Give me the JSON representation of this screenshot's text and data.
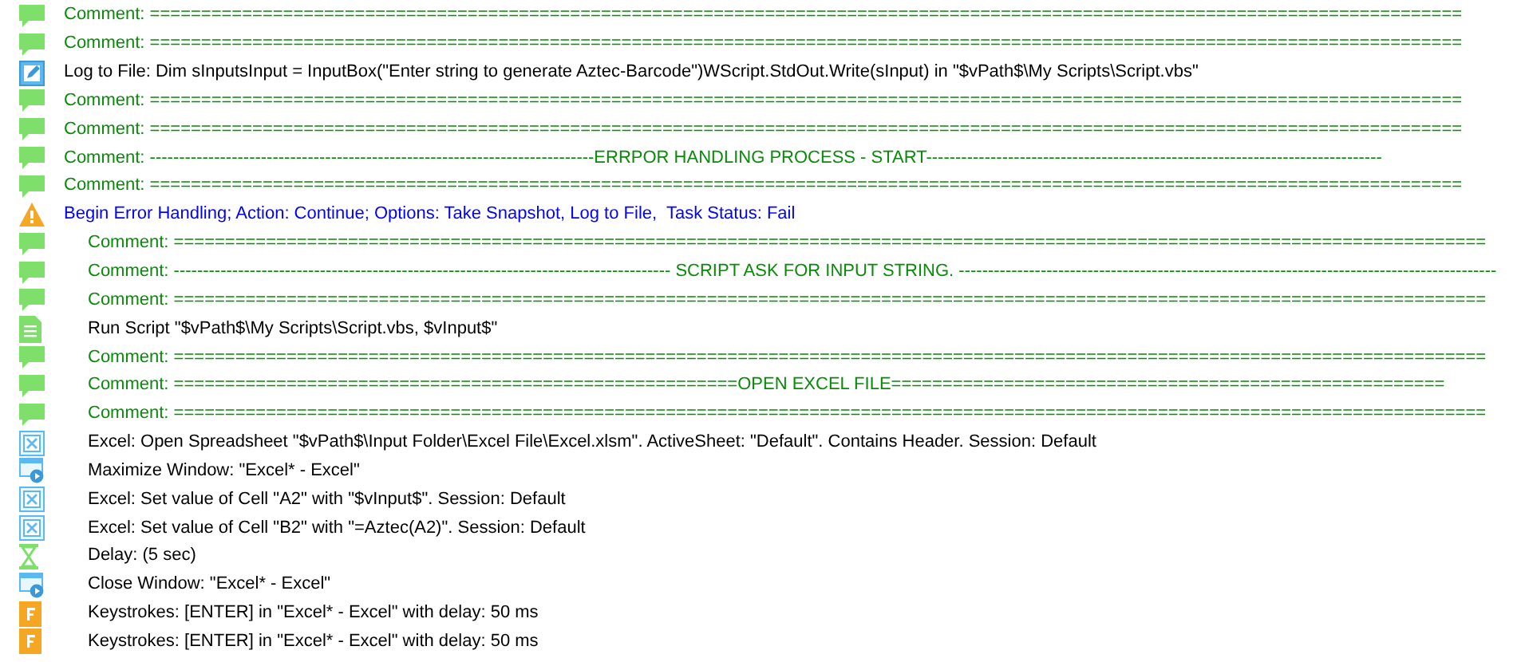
{
  "steps": [
    {
      "kind": "comment",
      "text": "Comment: ================================================================================================================================"
    },
    {
      "kind": "comment",
      "text": "Comment: ================================================================================================================================"
    },
    {
      "kind": "log",
      "text": "Log to File: Dim sInputsInput = InputBox(\"Enter string to generate Aztec-Barcode\")WScript.StdOut.Write(sInput) in \"$vPath$\\My Scripts\\Script.vbs\""
    },
    {
      "kind": "comment",
      "text": "Comment: ================================================================================================================================"
    },
    {
      "kind": "comment",
      "text": "Comment: ================================================================================================================================"
    },
    {
      "kind": "comment",
      "text": "Comment: ----------------------------------------------------------------------------ERRPOR HANDLING PROCESS - START------------------------------------------------------------------------------"
    },
    {
      "kind": "comment",
      "text": "Comment: ================================================================================================================================"
    },
    {
      "kind": "error",
      "text": "Begin Error Handling; Action: Continue; Options: Take Snapshot, Log to File,  Task Status: Fail",
      "children": [
        {
          "kind": "comment",
          "text": "Comment: ================================================================================================================================"
        },
        {
          "kind": "comment",
          "text": "Comment: ------------------------------------------------------------------------------------- SCRIPT ASK FOR INPUT STRING. --------------------------------------------------------------------------------------------"
        },
        {
          "kind": "comment",
          "text": "Comment: ================================================================================================================================"
        },
        {
          "kind": "script",
          "text": "Run Script \"$vPath$\\My Scripts\\Script.vbs, $vInput$\""
        },
        {
          "kind": "comment",
          "text": "Comment: ================================================================================================================================"
        },
        {
          "kind": "comment",
          "text": "Comment: =======================================================OPEN EXCEL FILE======================================================"
        },
        {
          "kind": "comment",
          "text": "Comment: ================================================================================================================================"
        },
        {
          "kind": "excel",
          "text": "Excel: Open Spreadsheet \"$vPath$\\Input Folder\\Excel File\\Excel.xlsm\". ActiveSheet: \"Default\". Contains Header. Session: Default"
        },
        {
          "kind": "window",
          "text": "Maximize Window: \"Excel* - Excel\""
        },
        {
          "kind": "excel",
          "text": "Excel: Set value of Cell \"A2\" with \"$vInput$\". Session: Default"
        },
        {
          "kind": "excel",
          "text": "Excel: Set value of Cell \"B2\" with \"=Aztec(A2)\". Session: Default"
        },
        {
          "kind": "delay",
          "text": "Delay: (5 sec)"
        },
        {
          "kind": "window",
          "text": "Close Window: \"Excel* - Excel\""
        },
        {
          "kind": "keys",
          "text": "Keystrokes: [ENTER] in \"Excel* - Excel\" with delay: 50 ms"
        },
        {
          "kind": "keys",
          "text": "Keystrokes: [ENTER] in \"Excel* - Excel\" with delay: 50 ms"
        }
      ]
    }
  ]
}
